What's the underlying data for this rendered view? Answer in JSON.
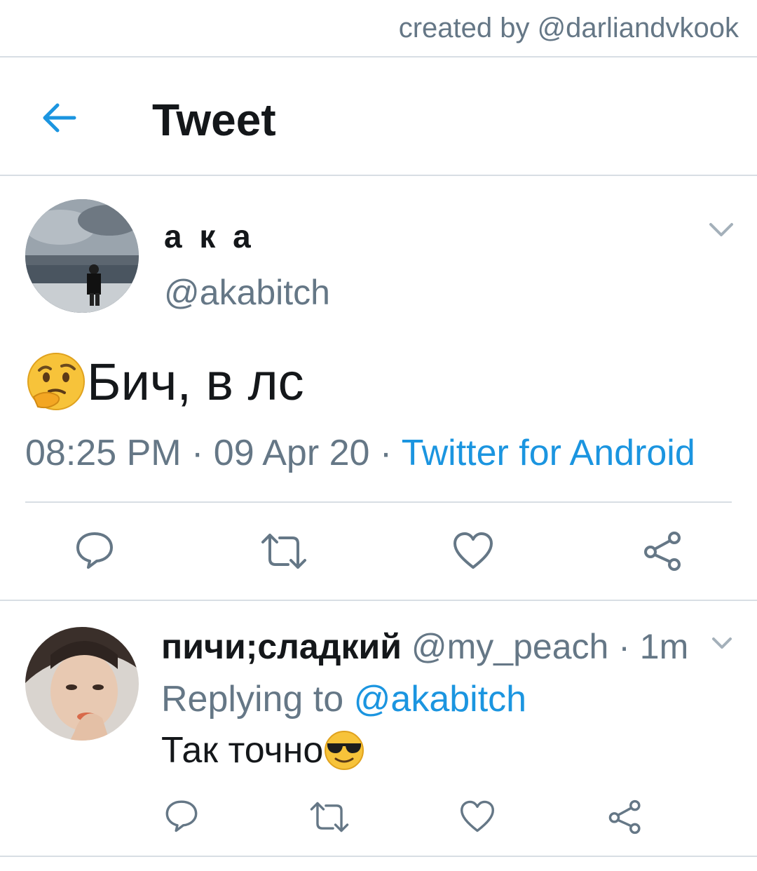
{
  "credit": "created by @darliandvkook",
  "header": {
    "title": "Tweet",
    "back_icon": "arrow-left-icon"
  },
  "colors": {
    "accent": "#1b95e0",
    "secondary_text": "#657786",
    "primary_text": "#14171a",
    "divider": "#d8dee4"
  },
  "tweet": {
    "display_name": "а к а",
    "handle": "@akabitch",
    "emoji": "thinking-face",
    "text": "Бич, в лс",
    "time": "08:25 PM",
    "sep1": " · ",
    "date": "09 Apr 20",
    "sep2": " · ",
    "source": "Twitter for Android"
  },
  "actions_icons": [
    "reply-icon",
    "retweet-icon",
    "like-icon",
    "share-icon"
  ],
  "reply": {
    "display_name": "пичи;сладкий",
    "handle": "@my_peach",
    "dot": " · ",
    "time": "1m",
    "replying_prefix": "Replying to ",
    "replying_to": "@akabitch",
    "text": "Так точно",
    "emoji": "smiling-face-with-sunglasses"
  }
}
